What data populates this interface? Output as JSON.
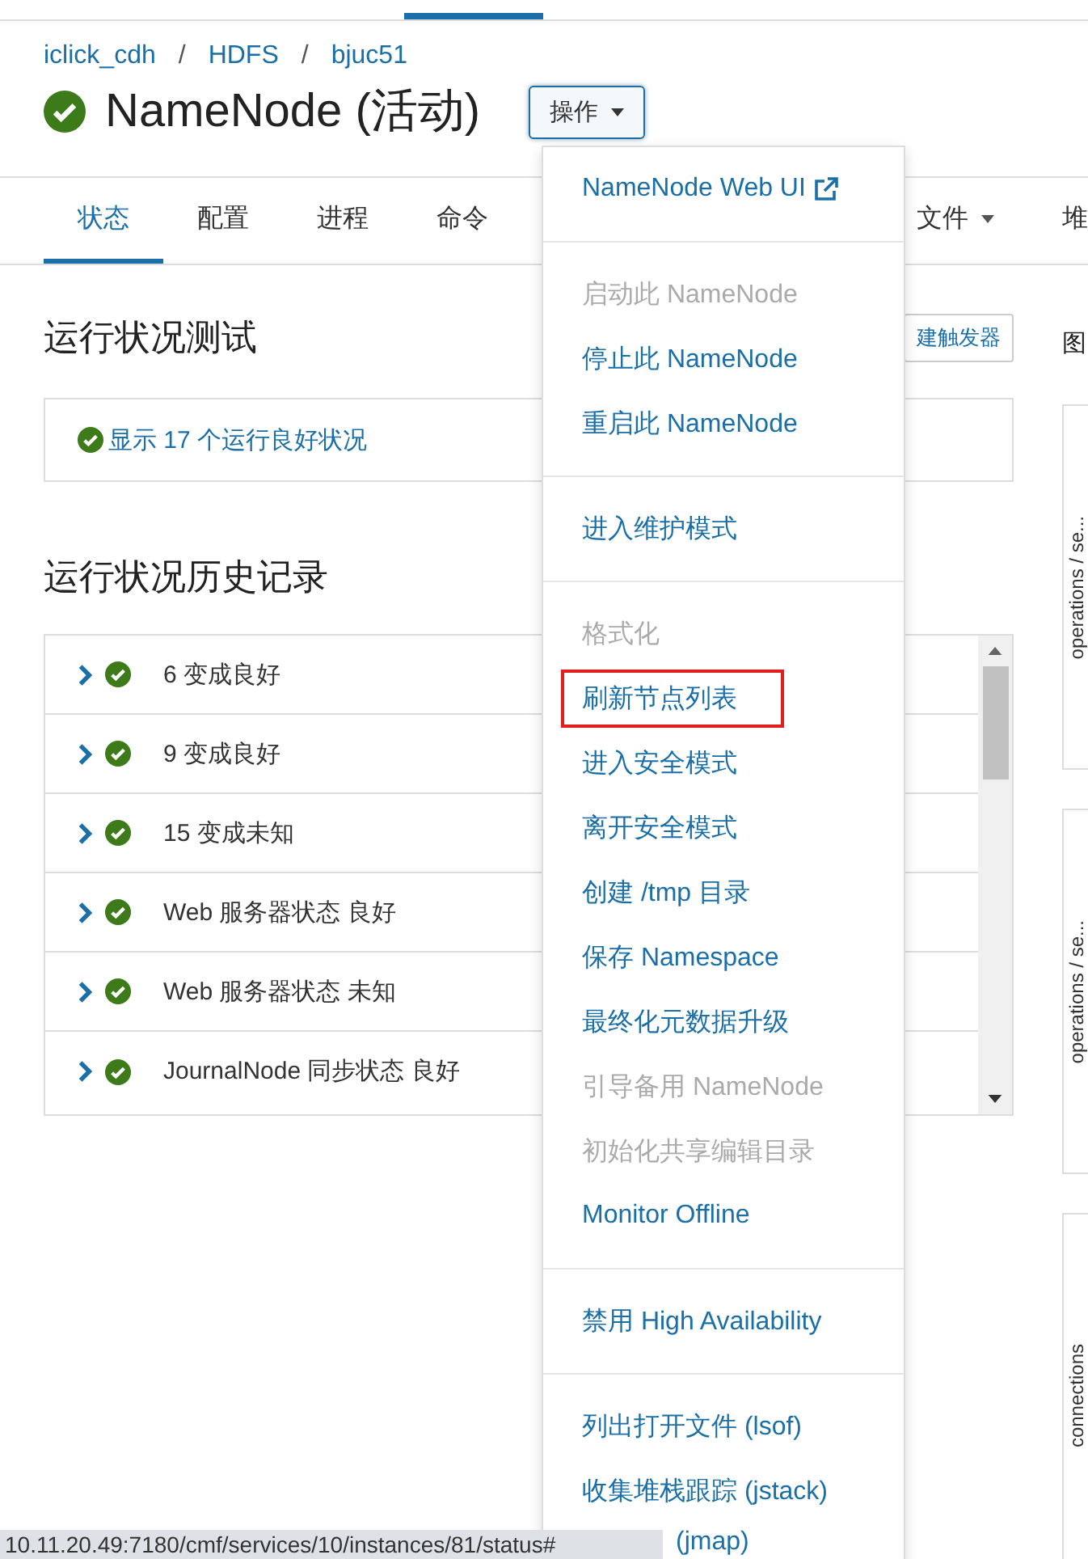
{
  "breadcrumb": {
    "items": [
      "iclick_cdh",
      "HDFS",
      "bjuc51"
    ],
    "separator": "/"
  },
  "title": {
    "text": "NameNode (活动)",
    "healthy": true
  },
  "actions_button": {
    "label": "操作",
    "expanded": true
  },
  "tabs": [
    {
      "label": "状态",
      "selected": true,
      "dropdown": false
    },
    {
      "label": "配置",
      "selected": false,
      "dropdown": false
    },
    {
      "label": "进程",
      "selected": false,
      "dropdown": false
    },
    {
      "label": "命令",
      "selected": false,
      "dropdown": false
    },
    {
      "label": "文件",
      "selected": false,
      "dropdown": true
    },
    {
      "label": "堆",
      "selected": false,
      "dropdown": false
    }
  ],
  "health_tests": {
    "title": "运行状况测试",
    "trigger_button": "建触发器",
    "summary": "显示 17 个运行良好状况",
    "healthy": true
  },
  "health_history": {
    "title": "运行状况历史记录",
    "rows": [
      {
        "text": "6 变成良好",
        "expanded": false,
        "healthy": true
      },
      {
        "text": "9 变成良好",
        "expanded": false,
        "healthy": true
      },
      {
        "text": "15 变成未知",
        "expanded": false,
        "healthy": true
      },
      {
        "text": "Web 服务器状态 良好",
        "expanded": false,
        "healthy": true
      },
      {
        "text": "Web 服务器状态 未知",
        "expanded": false,
        "healthy": true
      },
      {
        "text": "JournalNode 同步状态 良好",
        "expanded": false,
        "healthy": true
      }
    ]
  },
  "charts_panel": {
    "title": "图",
    "charts": [
      {
        "label": "operations / se..."
      },
      {
        "label": "operations / se..."
      },
      {
        "label": "connections"
      }
    ]
  },
  "actions_menu": {
    "groups": [
      [
        {
          "label": "NameNode Web UI",
          "external": true,
          "disabled": false,
          "highlighted": false,
          "partly_hidden": false
        }
      ],
      [
        {
          "label": "启动此 NameNode",
          "external": false,
          "disabled": true,
          "highlighted": false,
          "partly_hidden": false
        },
        {
          "label": "停止此 NameNode",
          "external": false,
          "disabled": false,
          "highlighted": false,
          "partly_hidden": false
        },
        {
          "label": "重启此 NameNode",
          "external": false,
          "disabled": false,
          "highlighted": false,
          "partly_hidden": false
        }
      ],
      [
        {
          "label": "进入维护模式",
          "external": false,
          "disabled": false,
          "highlighted": false,
          "partly_hidden": false
        }
      ],
      [
        {
          "label": "格式化",
          "external": false,
          "disabled": true,
          "highlighted": false,
          "partly_hidden": false
        },
        {
          "label": "刷新节点列表",
          "external": false,
          "disabled": false,
          "highlighted": true,
          "partly_hidden": false
        },
        {
          "label": "进入安全模式",
          "external": false,
          "disabled": false,
          "highlighted": false,
          "partly_hidden": false
        },
        {
          "label": "离开安全模式",
          "external": false,
          "disabled": false,
          "highlighted": false,
          "partly_hidden": false
        },
        {
          "label": "创建 /tmp 目录",
          "external": false,
          "disabled": false,
          "highlighted": false,
          "partly_hidden": false
        },
        {
          "label": "保存 Namespace",
          "external": false,
          "disabled": false,
          "highlighted": false,
          "partly_hidden": false
        },
        {
          "label": "最终化元数据升级",
          "external": false,
          "disabled": false,
          "highlighted": false,
          "partly_hidden": false
        },
        {
          "label": "引导备用 NameNode",
          "external": false,
          "disabled": true,
          "highlighted": false,
          "partly_hidden": false
        },
        {
          "label": "初始化共享编辑目录",
          "external": false,
          "disabled": true,
          "highlighted": false,
          "partly_hidden": false
        },
        {
          "label": "Monitor Offline",
          "external": false,
          "disabled": false,
          "highlighted": false,
          "partly_hidden": false
        }
      ],
      [
        {
          "label": "禁用 High Availability",
          "external": false,
          "disabled": false,
          "highlighted": false,
          "partly_hidden": false
        }
      ],
      [
        {
          "label": "列出打开文件 (lsof)",
          "external": false,
          "disabled": false,
          "highlighted": false,
          "partly_hidden": false
        },
        {
          "label": "收集堆栈跟踪 (jstack)",
          "external": false,
          "disabled": false,
          "highlighted": false,
          "partly_hidden": false
        },
        {
          "label": "(jmap)",
          "external": false,
          "disabled": false,
          "highlighted": false,
          "partly_hidden": true
        }
      ]
    ]
  },
  "status_bar": "10.11.20.49:7180/cmf/services/10/instances/81/status#"
}
